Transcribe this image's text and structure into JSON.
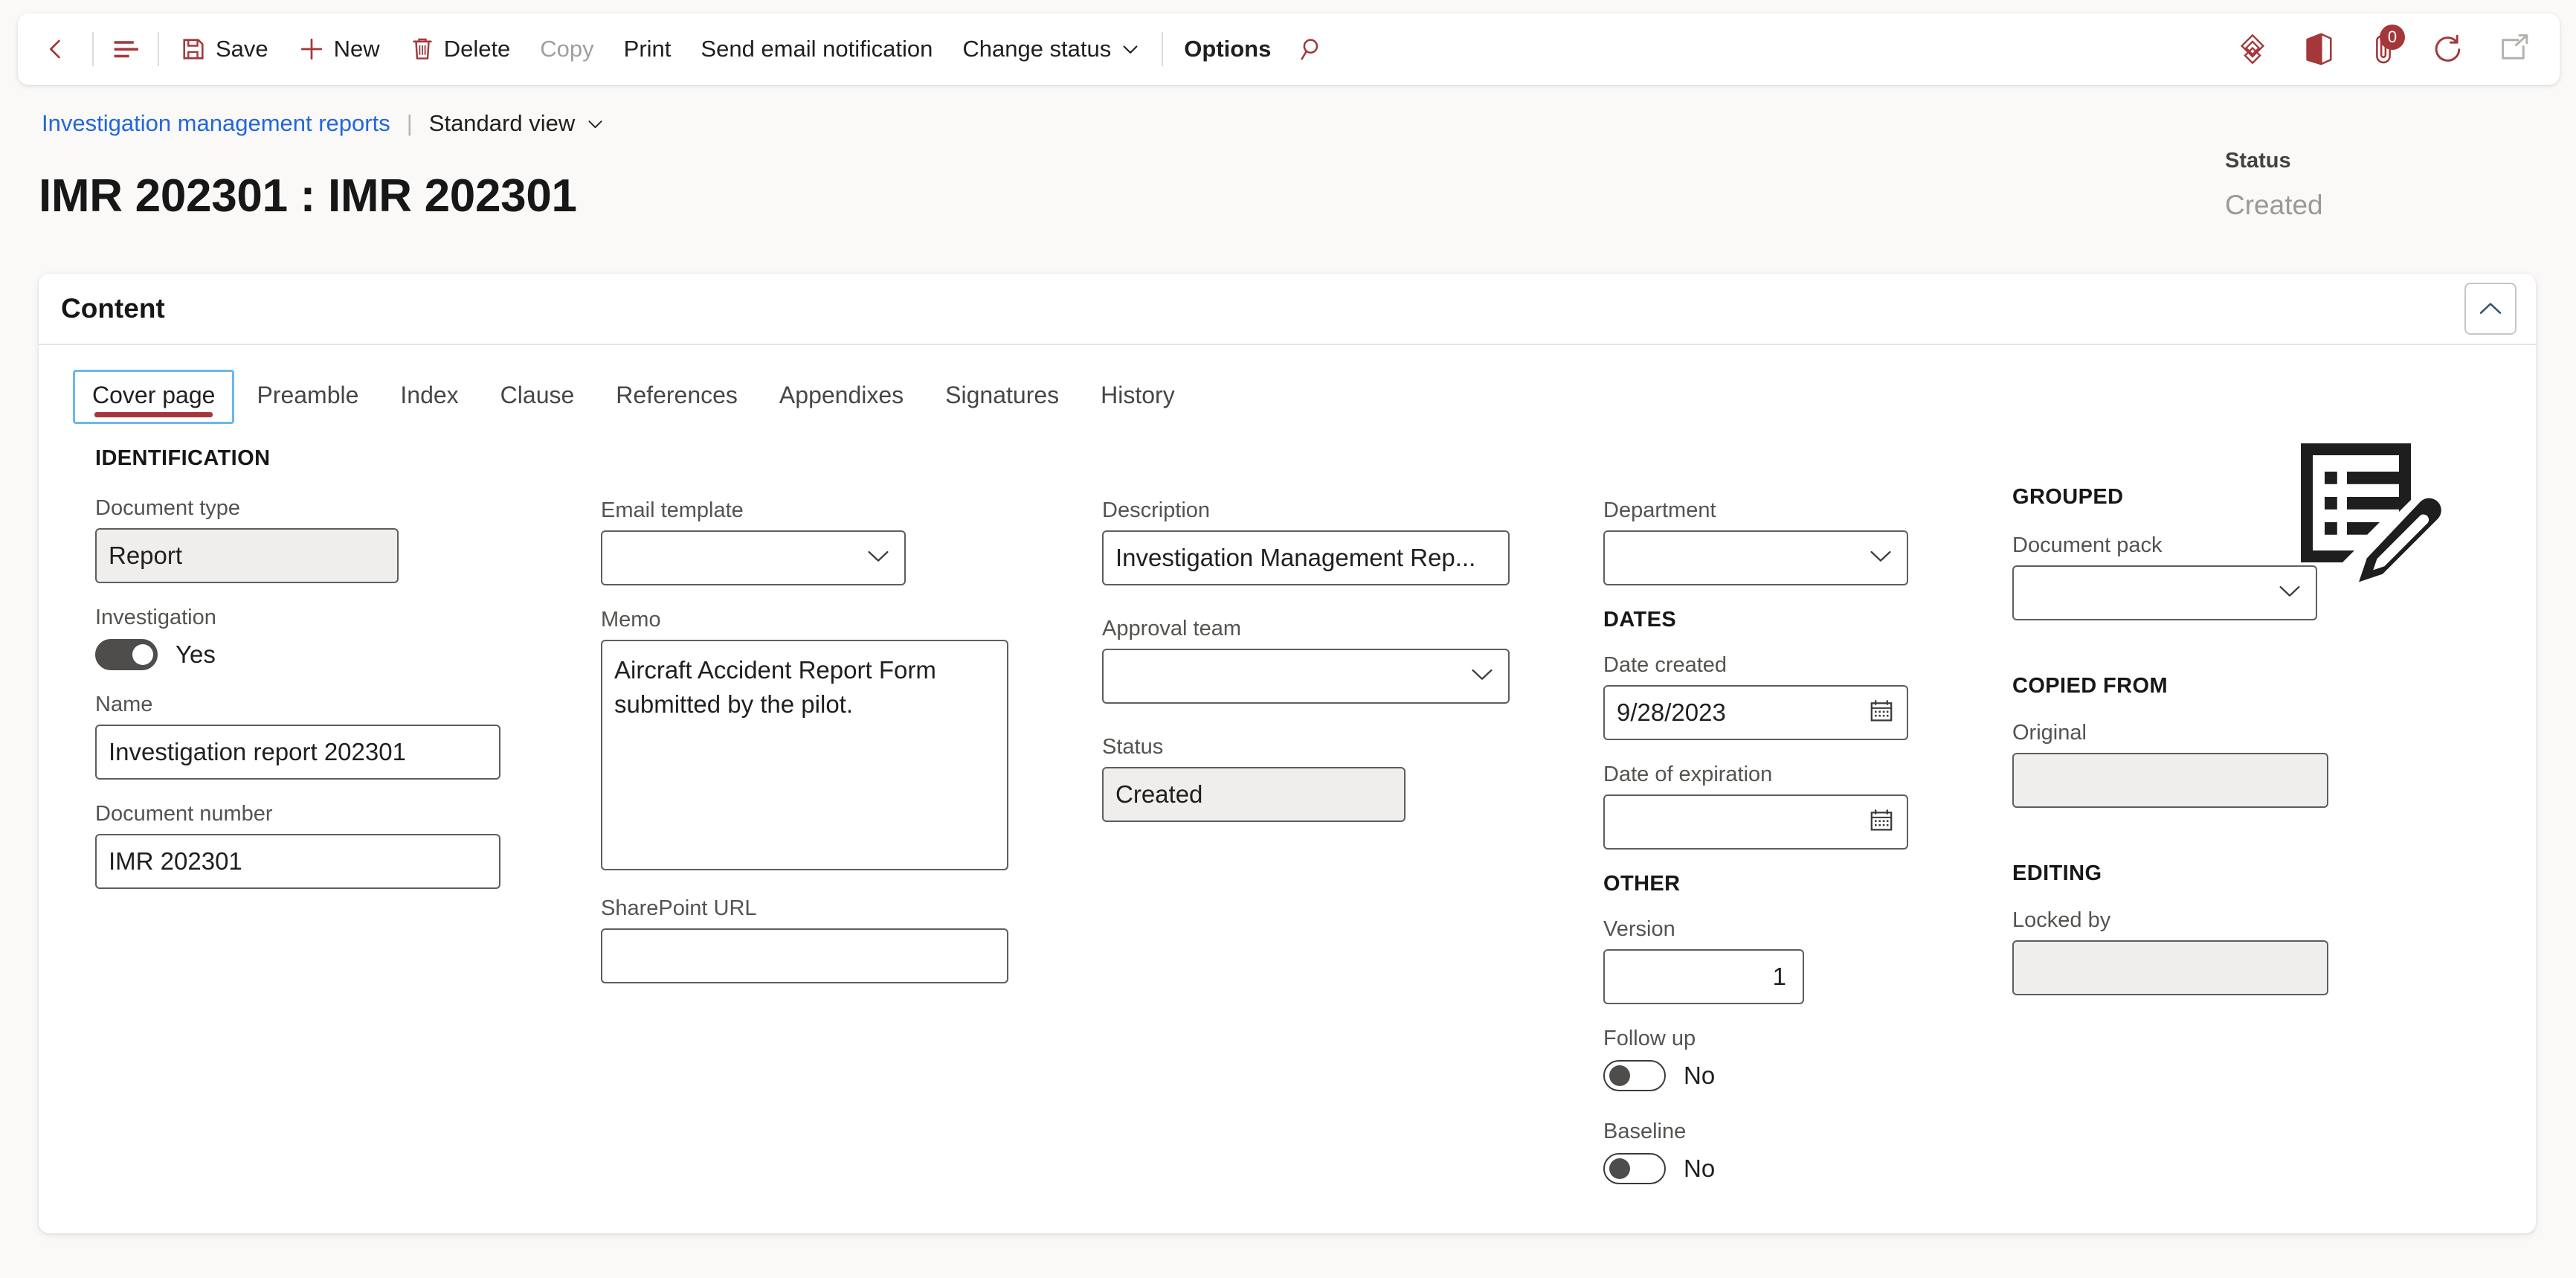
{
  "toolbar": {
    "back_label": "Back",
    "showlist_label": "Show list",
    "save_label": "Save",
    "new_label": "New",
    "delete_label": "Delete",
    "copy_label": "Copy",
    "print_label": "Print",
    "send_email_label": "Send email notification",
    "change_status_label": "Change status",
    "options_label": "Options",
    "search_label": "Search",
    "attachments_badge": "0",
    "icons": {
      "back": "arrow-left-icon",
      "showlist": "list-lines-icon",
      "save": "floppy-disk-icon",
      "new": "plus-icon",
      "delete": "trash-icon",
      "change_status_chevron": "chevron-down-icon",
      "search": "magnifier-icon",
      "diamond": "diamond-pattern-icon",
      "office": "office-app-icon",
      "attach": "paperclip-icon",
      "refresh": "refresh-circle-icon",
      "popout": "open-in-new-window-icon"
    }
  },
  "breadcrumb": {
    "parent": "Investigation management reports",
    "separator": "|",
    "view": "Standard view"
  },
  "header": {
    "title": "IMR 202301 : IMR 202301",
    "status_label": "Status",
    "status_value": "Created"
  },
  "content_panel": {
    "title": "Content",
    "collapse_label": "Collapse"
  },
  "tabs": [
    {
      "label": "Cover page",
      "active": true
    },
    {
      "label": "Preamble",
      "active": false
    },
    {
      "label": "Index",
      "active": false
    },
    {
      "label": "Clause",
      "active": false
    },
    {
      "label": "References",
      "active": false
    },
    {
      "label": "Appendixes",
      "active": false
    },
    {
      "label": "Signatures",
      "active": false
    },
    {
      "label": "History",
      "active": false
    }
  ],
  "form": {
    "groups": {
      "identification": "IDENTIFICATION",
      "dates": "DATES",
      "other": "OTHER",
      "grouped": "GROUPED",
      "copied_from": "COPIED FROM",
      "editing": "EDITING"
    },
    "document_type": {
      "label": "Document type",
      "value": "Report",
      "readonly": true
    },
    "investigation": {
      "label": "Investigation",
      "value": "Yes",
      "on": true
    },
    "name": {
      "label": "Name",
      "value": "Investigation report 202301"
    },
    "document_number": {
      "label": "Document number",
      "value": "IMR 202301"
    },
    "email_template": {
      "label": "Email template",
      "value": ""
    },
    "memo": {
      "label": "Memo",
      "value": "Aircraft Accident Report Form submitted by the pilot."
    },
    "sharepoint_url": {
      "label": "SharePoint URL",
      "value": ""
    },
    "description": {
      "label": "Description",
      "value": "Investigation Management Rep..."
    },
    "approval_team": {
      "label": "Approval team",
      "value": ""
    },
    "status": {
      "label": "Status",
      "value": "Created",
      "readonly": true
    },
    "department": {
      "label": "Department",
      "value": ""
    },
    "date_created": {
      "label": "Date created",
      "value": "9/28/2023"
    },
    "date_of_expiration": {
      "label": "Date of expiration",
      "value": ""
    },
    "version": {
      "label": "Version",
      "value": "1"
    },
    "follow_up": {
      "label": "Follow up",
      "value": "No",
      "on": false
    },
    "baseline": {
      "label": "Baseline",
      "value": "No",
      "on": false
    },
    "document_pack": {
      "label": "Document pack",
      "value": ""
    },
    "original": {
      "label": "Original",
      "value": "",
      "readonly": true
    },
    "locked_by": {
      "label": "Locked by",
      "value": "",
      "readonly": true
    }
  },
  "colors": {
    "brand": "#a4373a",
    "link": "#2266dd",
    "page_bg": "#faf9f8",
    "readonly_bg": "#efeeed"
  }
}
